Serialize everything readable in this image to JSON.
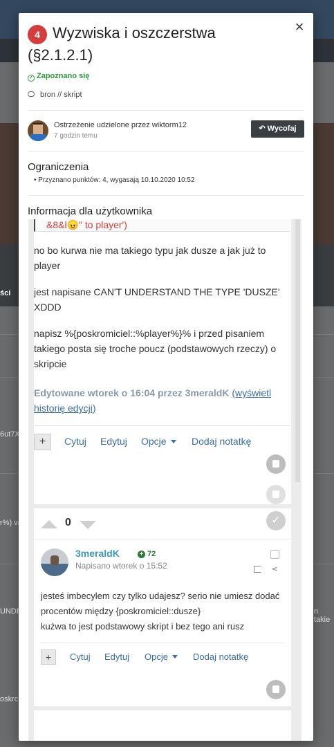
{
  "background": {
    "fragments": [
      "ści",
      "6ut7X",
      "r%) va",
      "UNDE",
      "n takie",
      "oskrc"
    ]
  },
  "modal": {
    "close_label": "×",
    "points_badge": "4",
    "title_line1": "Wyzwiska i oszczerstwa",
    "title_line2": "(§2.1.2.1)",
    "acknowledged": "Zapoznano się",
    "content_link": "bron // skript",
    "author_line": "Ostrzeżenie udzielone przez wiktorm12",
    "author_time": "7 godzin temu",
    "revoke_label": "Wycofaj",
    "restrictions_title": "Ograniczenia",
    "restriction_item": "Przyznano punktów: 4, wygasają 10.10.2020 10:52",
    "info_title": "Informacja dla użytkownika"
  },
  "content": {
    "quote_tail": "&8&l😠\" to player')",
    "post1_paragraphs": [
      "no bo kurwa nie ma takiego typu jak dusze a jak już to player",
      "jest napisane CAN'T UNDERSTAND THE TYPE 'DUSZE' XDDD",
      "napisz %{poskromiciel::%player%}% i przed pisaniem takiego posta się troche poucz (podstawowych rzeczy) o skripcie"
    ],
    "edit_note": "Edytowane wtorek o 16:04 przez 3meraldK",
    "edit_history_link": "(wyświetl historię edycji)",
    "actions": {
      "plus": "+",
      "quote": "Cytuj",
      "edit": "Edytuj",
      "options": "Opcje",
      "note": "Dodaj notatkę"
    },
    "post2": {
      "vote_count": "0",
      "username": "3meraldK",
      "reputation": "72",
      "posted": "Napisano wtorek o 15:52",
      "paragraphs": [
        "jesteś imbecylem czy tylko udajesz? serio nie umiesz dodać procentów między {poskromiciel::dusze}",
        "kuźwa to jest podstawowy skript i bez tego ani rusz"
      ]
    }
  },
  "colors": {
    "badge": "#d43d3d",
    "ack": "#2d9a3a",
    "link": "#3a6ea5",
    "username": "#3a9ab5",
    "revoke_bg": "#3a3f44"
  }
}
